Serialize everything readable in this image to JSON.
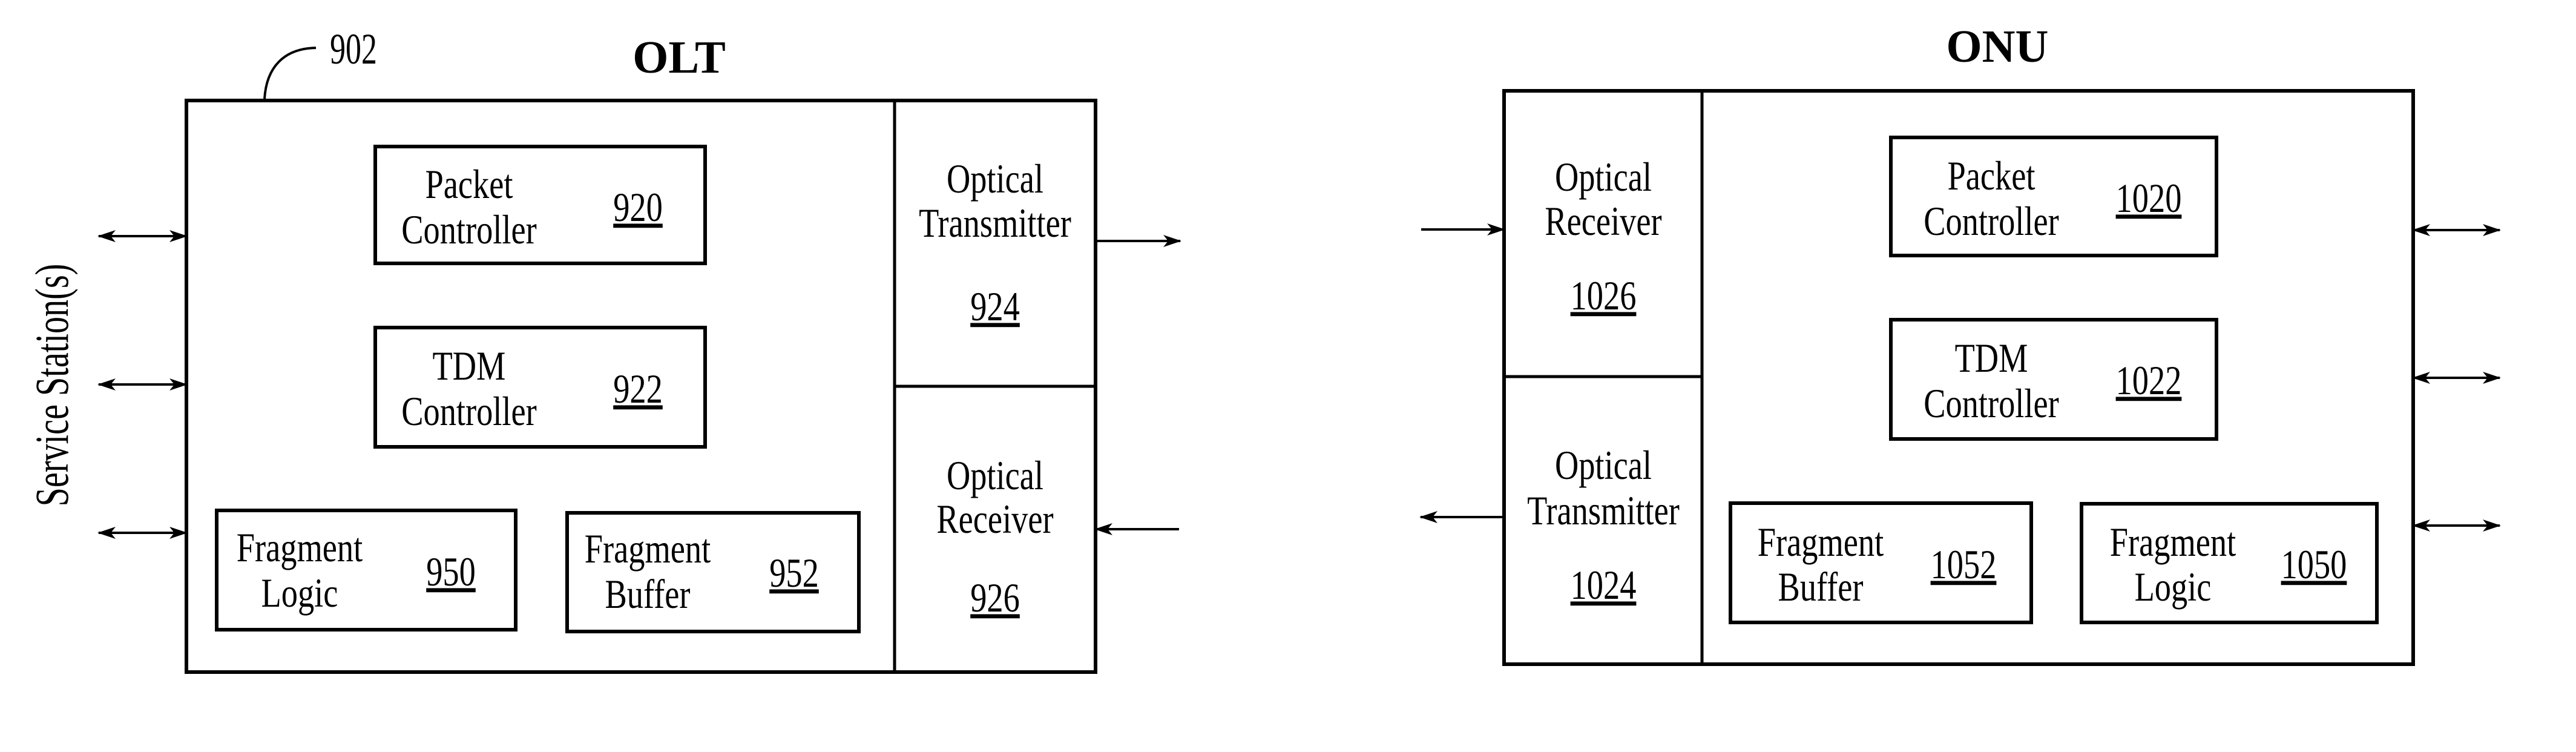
{
  "figure": {
    "olt": {
      "title": "OLT",
      "reference": "902",
      "side_label": "Service Station(s)",
      "blocks": {
        "packet_controller": {
          "line1": "Packet",
          "line2": "Controller",
          "number": "920"
        },
        "tdm_controller": {
          "line1": "TDM",
          "line2": "Controller",
          "number": "922"
        },
        "fragment_logic": {
          "line1": "Fragment",
          "line2": "Logic",
          "number": "950"
        },
        "fragment_buffer": {
          "line1": "Fragment",
          "line2": "Buffer",
          "number": "952"
        },
        "optical_transmitter": {
          "line1": "Optical",
          "line2": "Transmitter",
          "number": "924"
        },
        "optical_receiver": {
          "line1": "Optical",
          "line2": "Receiver",
          "number": "926"
        }
      }
    },
    "onu": {
      "title": "ONU",
      "blocks": {
        "optical_receiver": {
          "line1": "Optical",
          "line2": "Receiver",
          "number": "1026"
        },
        "optical_transmitter": {
          "line1": "Optical",
          "line2": "Transmitter",
          "number": "1024"
        },
        "packet_controller": {
          "line1": "Packet",
          "line2": "Controller",
          "number": "1020"
        },
        "tdm_controller": {
          "line1": "TDM",
          "line2": "Controller",
          "number": "1022"
        },
        "fragment_buffer": {
          "line1": "Fragment",
          "line2": "Buffer",
          "number": "1052"
        },
        "fragment_logic": {
          "line1": "Fragment",
          "line2": "Logic",
          "number": "1050"
        }
      }
    }
  }
}
